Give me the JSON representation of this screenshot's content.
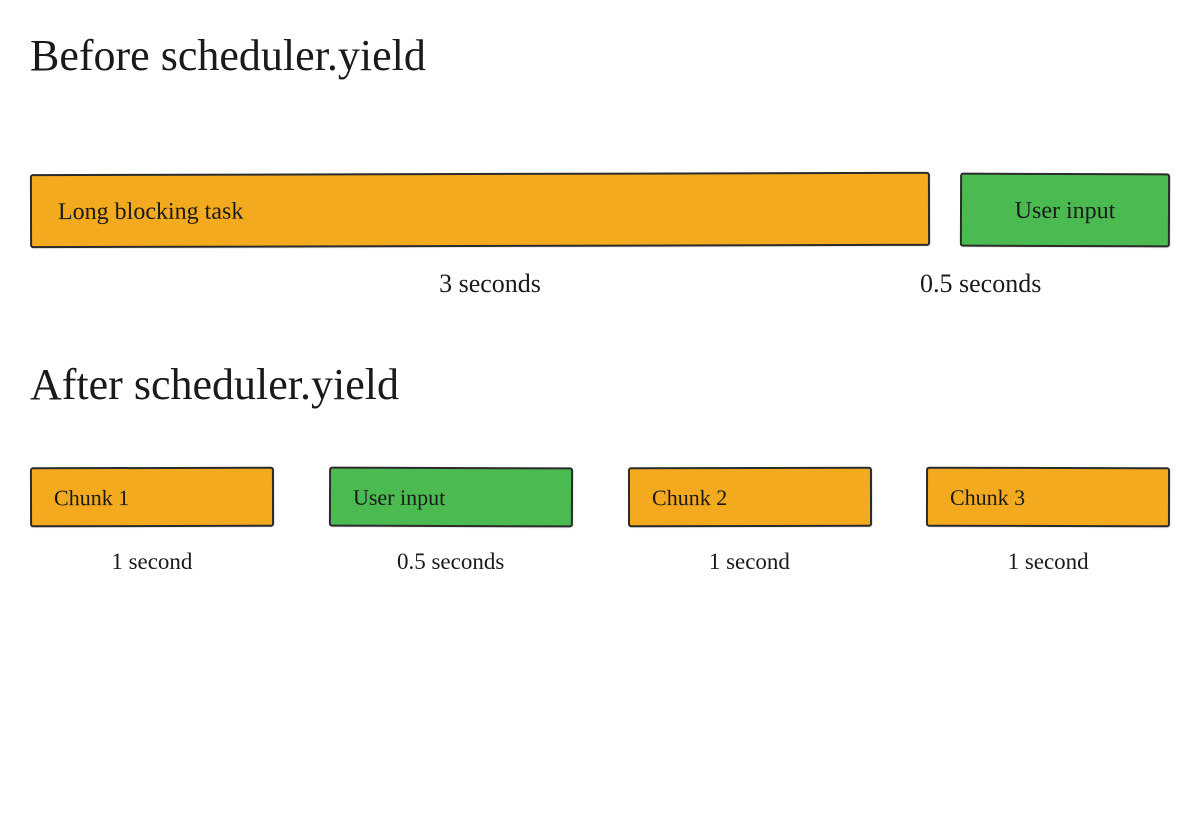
{
  "before": {
    "title": "Before scheduler.yield",
    "blocks": [
      {
        "label": "Long blocking task",
        "kind": "task",
        "duration_label": "3 seconds",
        "duration_seconds": 3
      },
      {
        "label": "User input",
        "kind": "input",
        "duration_label": "0.5 seconds",
        "duration_seconds": 0.5
      }
    ]
  },
  "after": {
    "title": "After scheduler.yield",
    "blocks": [
      {
        "label": "Chunk 1",
        "kind": "task",
        "duration_label": "1 second",
        "duration_seconds": 1
      },
      {
        "label": "User input",
        "kind": "input",
        "duration_label": "0.5 seconds",
        "duration_seconds": 0.5
      },
      {
        "label": "Chunk 2",
        "kind": "task",
        "duration_label": "1 second",
        "duration_seconds": 1
      },
      {
        "label": "Chunk 3",
        "kind": "task",
        "duration_label": "1 second",
        "duration_seconds": 1
      }
    ]
  },
  "colors": {
    "task": "#f3aa1e",
    "input": "#4bba51"
  }
}
